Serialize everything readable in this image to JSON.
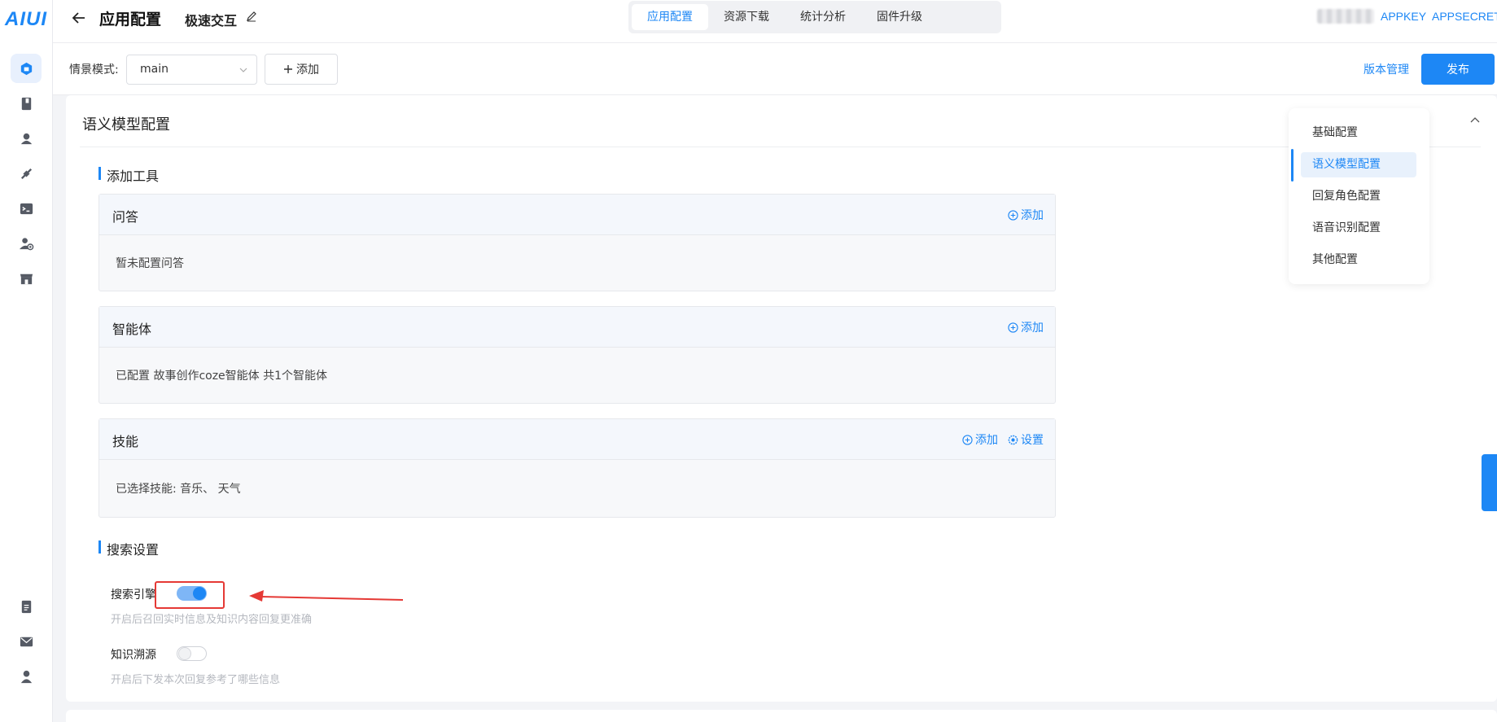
{
  "brand": {
    "logo_text": "AIUI",
    "accent": "#1d87f5"
  },
  "left_nav": {
    "top_icons": [
      "app-cube-icon",
      "book-icon",
      "robot-icon",
      "plugin-icon",
      "terminal-icon",
      "user-add-icon",
      "store-icon"
    ],
    "bottom_icons": [
      "document-icon",
      "mail-icon",
      "person-icon"
    ]
  },
  "header": {
    "page_title": "应用配置",
    "app_name": "极速交互",
    "tabs": [
      {
        "label": "应用配置",
        "active": true
      },
      {
        "label": "资源下载",
        "active": false
      },
      {
        "label": "统计分析",
        "active": false
      },
      {
        "label": "固件升级",
        "active": false
      }
    ],
    "appkey_label": "APPKEY",
    "appsecret_label": "APPSECRET"
  },
  "scene_bar": {
    "label": "情景模式:",
    "selected": "main",
    "add_label": "添加",
    "version_link": "版本管理",
    "publish_label": "发布"
  },
  "section": {
    "title": "语义模型配置",
    "tools_title": "添加工具",
    "tools": [
      {
        "name": "问答",
        "desc": "暂未配置问答",
        "actions": [
          "添加"
        ]
      },
      {
        "name": "智能体",
        "desc": "已配置 故事创作coze智能体 共1个智能体",
        "actions": [
          "添加"
        ]
      },
      {
        "name": "技能",
        "desc": "已选择技能:  音乐、 天气",
        "actions": [
          "添加",
          "设置"
        ]
      }
    ],
    "search_title": "搜索设置",
    "settings": [
      {
        "label": "搜索引擎",
        "enabled": true,
        "hint": "开启后召回实时信息及知识内容回复更准确"
      },
      {
        "label": "知识溯源",
        "enabled": false,
        "hint": "开启后下发本次回复参考了哪些信息"
      }
    ]
  },
  "anchor_menu": {
    "items": [
      {
        "label": "基础配置",
        "active": false
      },
      {
        "label": "语义模型配置",
        "active": true
      },
      {
        "label": "回复角色配置",
        "active": false
      },
      {
        "label": "语音识别配置",
        "active": false
      },
      {
        "label": "其他配置",
        "active": false
      }
    ]
  }
}
